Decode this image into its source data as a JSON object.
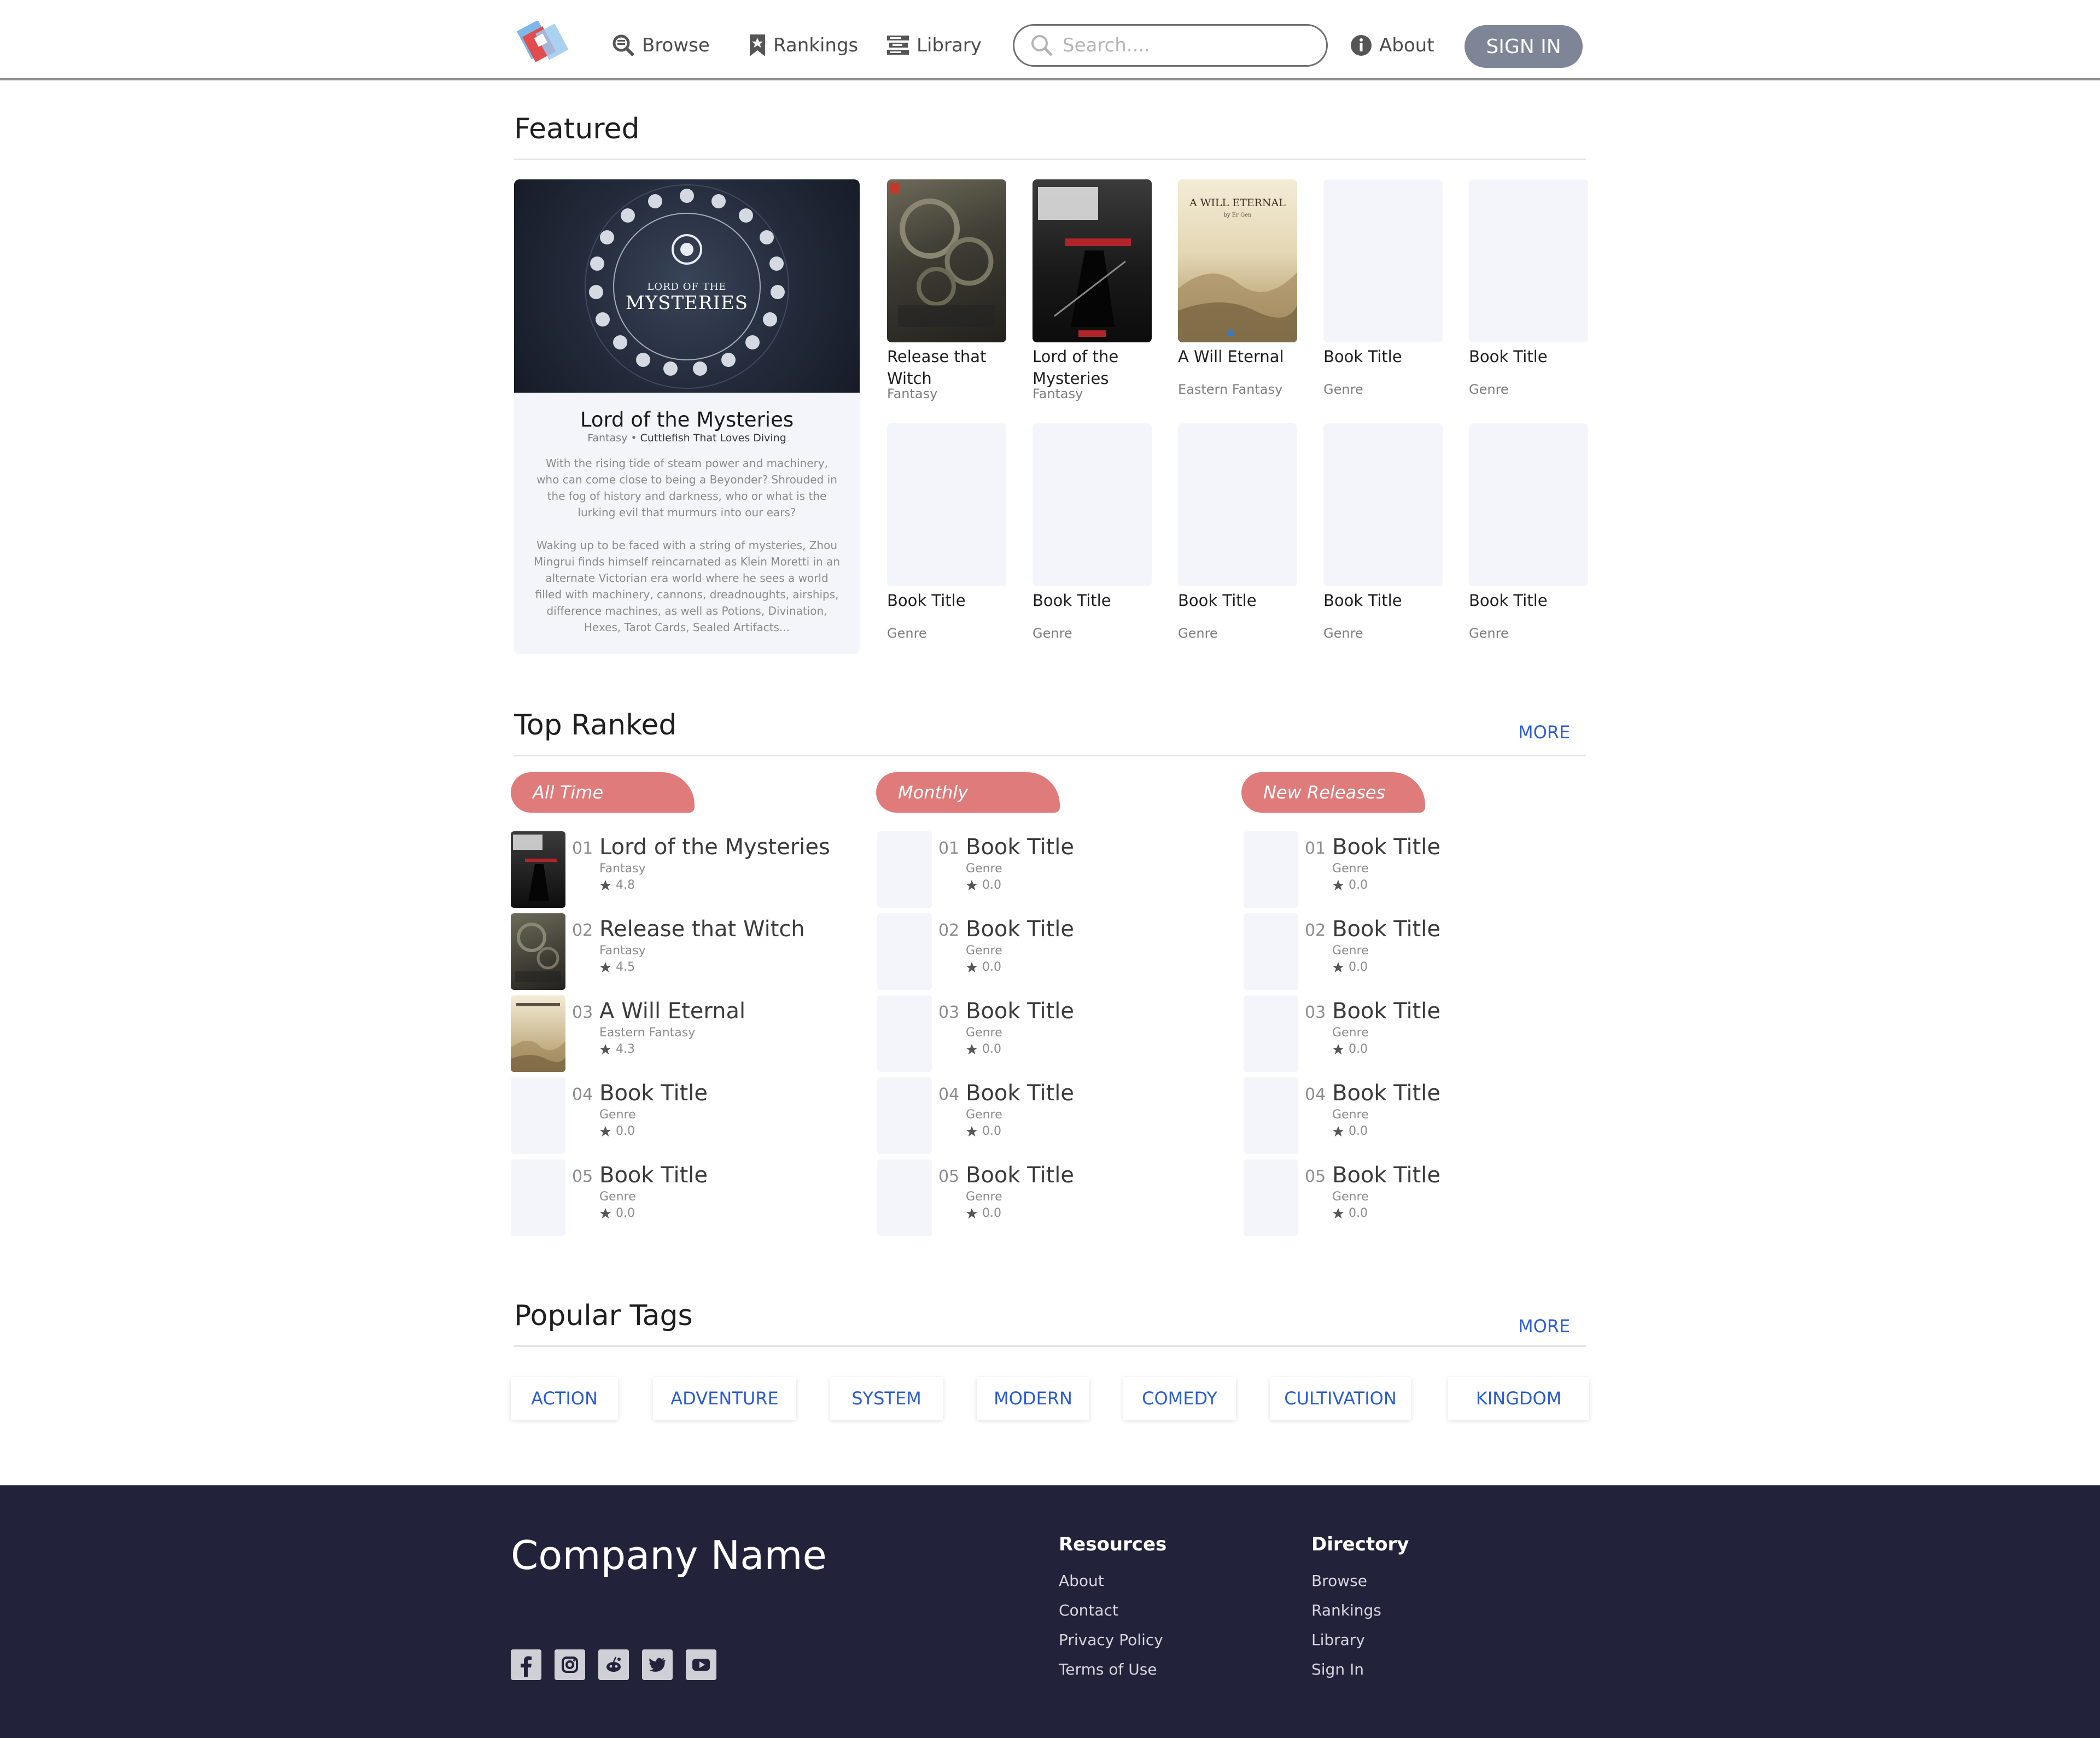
{
  "nav": {
    "browse": "Browse",
    "rankings": "Rankings",
    "library": "Library",
    "search_placeholder": "Search....",
    "about": "About",
    "signin": "SIGN IN"
  },
  "featured": {
    "heading": "Featured",
    "main": {
      "title": "Lord of the Mysteries",
      "genre": "Fantasy",
      "author": "Cuttlefish That Loves Diving",
      "cover_text_line1": "LORD OF THE",
      "cover_text_line2": "MYSTERIES",
      "desc1": "With the rising tide of steam power and machinery, who can come close to being a Beyonder? Shrouded in the fog of history and darkness, who or what is the lurking evil that murmurs into our ears?",
      "desc2": "Waking up to be faced with a string of mysteries, Zhou Mingrui finds himself reincarnated as Klein Moretti in an alternate Victorian era world where he sees a world filled with machinery, cannons, dreadnoughts, airships, difference machines, as well as Potions, Divination, Hexes, Tarot Cards, Sealed Artifacts..."
    },
    "books": [
      {
        "title": "Release that Witch",
        "genre": "Fantasy"
      },
      {
        "title": "Lord of the Mysteries",
        "genre": "Fantasy"
      },
      {
        "title": "A Will Eternal",
        "genre": "Eastern Fantasy",
        "cover_title": "A WILL ETERNAL",
        "cover_author": "by Er Gen"
      },
      {
        "title": "Book Title",
        "genre": "Genre"
      },
      {
        "title": "Book Title",
        "genre": "Genre"
      },
      {
        "title": "Book Title",
        "genre": "Genre"
      },
      {
        "title": "Book Title",
        "genre": "Genre"
      },
      {
        "title": "Book Title",
        "genre": "Genre"
      },
      {
        "title": "Book Title",
        "genre": "Genre"
      },
      {
        "title": "Book Title",
        "genre": "Genre"
      }
    ]
  },
  "top_ranked": {
    "heading": "Top Ranked",
    "more": "MORE",
    "columns": [
      {
        "tab": "All Time",
        "items": [
          {
            "num": "01",
            "title": "Lord of the Mysteries",
            "genre": "Fantasy",
            "rating": "4.8"
          },
          {
            "num": "02",
            "title": "Release that Witch",
            "genre": "Fantasy",
            "rating": "4.5"
          },
          {
            "num": "03",
            "title": "A Will Eternal",
            "genre": "Eastern Fantasy",
            "rating": "4.3"
          },
          {
            "num": "04",
            "title": "Book Title",
            "genre": "Genre",
            "rating": "0.0"
          },
          {
            "num": "05",
            "title": "Book Title",
            "genre": "Genre",
            "rating": "0.0"
          }
        ]
      },
      {
        "tab": "Monthly",
        "items": [
          {
            "num": "01",
            "title": "Book Title",
            "genre": "Genre",
            "rating": "0.0"
          },
          {
            "num": "02",
            "title": "Book Title",
            "genre": "Genre",
            "rating": "0.0"
          },
          {
            "num": "03",
            "title": "Book Title",
            "genre": "Genre",
            "rating": "0.0"
          },
          {
            "num": "04",
            "title": "Book Title",
            "genre": "Genre",
            "rating": "0.0"
          },
          {
            "num": "05",
            "title": "Book Title",
            "genre": "Genre",
            "rating": "0.0"
          }
        ]
      },
      {
        "tab": "New Releases",
        "items": [
          {
            "num": "01",
            "title": "Book Title",
            "genre": "Genre",
            "rating": "0.0"
          },
          {
            "num": "02",
            "title": "Book Title",
            "genre": "Genre",
            "rating": "0.0"
          },
          {
            "num": "03",
            "title": "Book Title",
            "genre": "Genre",
            "rating": "0.0"
          },
          {
            "num": "04",
            "title": "Book Title",
            "genre": "Genre",
            "rating": "0.0"
          },
          {
            "num": "05",
            "title": "Book Title",
            "genre": "Genre",
            "rating": "0.0"
          }
        ]
      }
    ]
  },
  "popular_tags": {
    "heading": "Popular Tags",
    "more": "MORE",
    "tags": [
      "ACTION",
      "ADVENTURE",
      "SYSTEM",
      "MODERN",
      "COMEDY",
      "CULTIVATION",
      "KINGDOM"
    ]
  },
  "footer": {
    "company": "Company Name",
    "resources_title": "Resources",
    "resources": [
      "About",
      "Contact",
      "Privacy Policy",
      "Terms of Use"
    ],
    "directory_title": "Directory",
    "directory": [
      "Browse",
      "Rankings",
      "Library",
      "Sign In"
    ],
    "social_icons": [
      "facebook-icon",
      "instagram-icon",
      "reddit-icon",
      "twitter-icon",
      "youtube-icon"
    ]
  },
  "colors": {
    "accent_tab": "#e07b7b",
    "link": "#2a5bd7",
    "footer_bg": "#22223b",
    "signin_bg": "#7d8597",
    "placeholder_cover": "#f4f5fa"
  }
}
